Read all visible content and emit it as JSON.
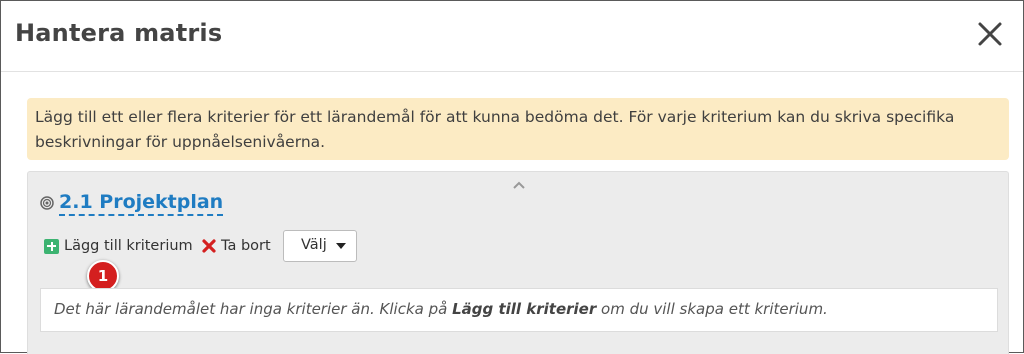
{
  "modal": {
    "title": "Hantera matris",
    "close_icon": "close-icon"
  },
  "info": {
    "text": "Lägg till ett eller flera kriterier för ett lärandemål för att kunna bedöma det. För varje kriterium kan du skriva specifika beskrivningar för uppnåelsenivåerna."
  },
  "outcome": {
    "title": "2.1 Projektplan",
    "icon": "target-icon",
    "add_label": "Lägg till kriterium",
    "remove_label": "Ta bort",
    "select_value": "Välj",
    "badge": "1",
    "empty_prefix": "Det här lärandemålet har inga kriterier än. Klicka på ",
    "empty_bold": "Lägg till kriterier",
    "empty_suffix": " om du vill skapa ett kriterium."
  },
  "colors": {
    "info_bg": "#fcebc4",
    "link": "#1f7cc2",
    "add_green": "#3cb371",
    "remove_red": "#d42020",
    "badge_red": "#d41f1f"
  }
}
